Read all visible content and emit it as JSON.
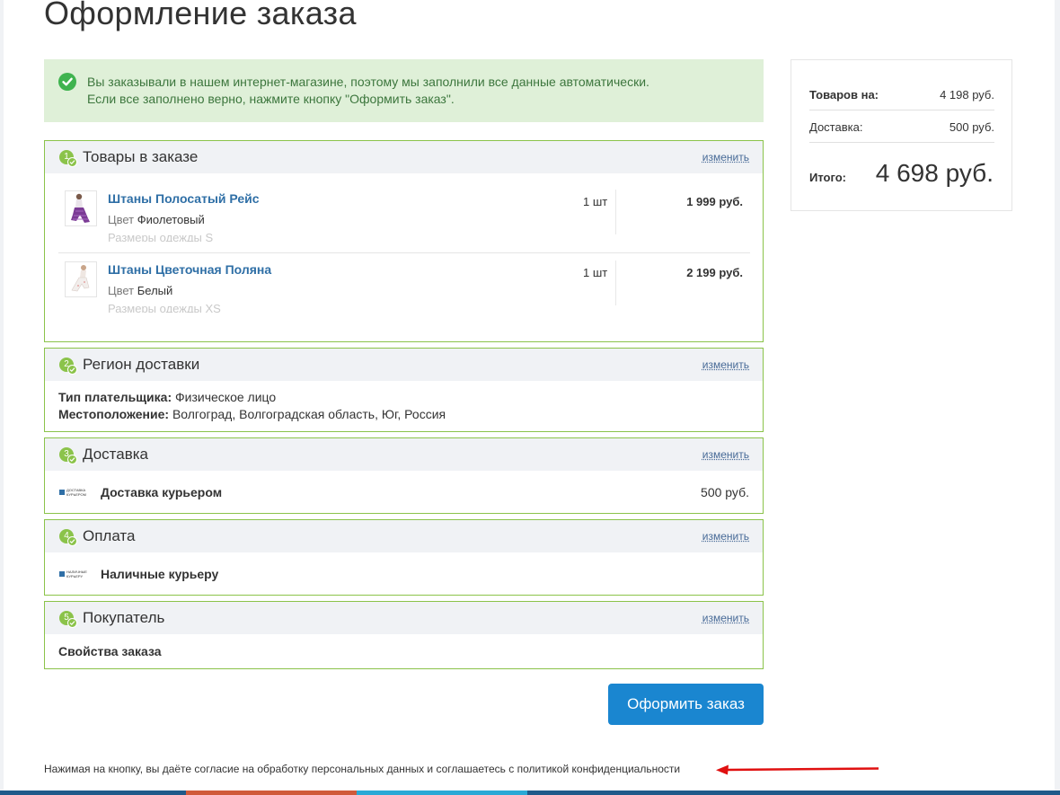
{
  "page": {
    "title": "Оформление заказа"
  },
  "notice": {
    "line1": "Вы заказывали в нашем интернет-магазине, поэтому мы заполнили все данные автоматически.",
    "line2": "Если все заполнено верно, нажмите кнопку \"Оформить заказ\"."
  },
  "change_label": "изменить",
  "sections": {
    "goods": {
      "num": "1",
      "title": "Товары в заказе"
    },
    "region": {
      "num": "2",
      "title": "Регион доставки"
    },
    "delivery": {
      "num": "3",
      "title": "Доставка"
    },
    "payment": {
      "num": "4",
      "title": "Оплата"
    },
    "buyer": {
      "num": "5",
      "title": "Покупатель"
    }
  },
  "products": [
    {
      "name": "Штаны Полосатый Рейс",
      "color_label": "Цвет",
      "color_value": "Фиолетовый",
      "size": "Размеры одежды S",
      "qty": "1 шт",
      "price": "1 999 руб."
    },
    {
      "name": "Штаны Цветочная Поляна",
      "color_label": "Цвет",
      "color_value": "Белый",
      "size": "Размеры одежды XS",
      "qty": "1 шт",
      "price": "2 199 руб."
    }
  ],
  "region": {
    "payer_label": "Тип плательщика:",
    "payer_value": "Физическое лицо",
    "location_label": "Местоположение:",
    "location_value": "Волгоград, Волгоградская область, Юг, Россия"
  },
  "delivery": {
    "logo_text1": "ДОСТАВКА",
    "logo_text2": "КУРЬЕРОМ",
    "name": "Доставка курьером",
    "price": "500 руб."
  },
  "payment": {
    "logo_text1": "НАЛИЧНЫЕ",
    "logo_text2": "КУРЬЕРУ",
    "name": "Наличные курьеру"
  },
  "buyer": {
    "props_label": "Свойства заказа"
  },
  "submit_label": "Оформить заказ",
  "consent": "Нажимая на кнопку, вы даёте согласие на обработку персональных данных и соглашаетесь с политикой конфиденциальности",
  "summary": {
    "goods_label": "Товаров на:",
    "goods_value": "4 198 руб.",
    "delivery_label": "Доставка:",
    "delivery_value": "500 руб.",
    "total_label": "Итого:",
    "total_value": "4 698 руб."
  },
  "colors": {
    "accent_green": "#8bc34a",
    "button_blue": "#1a86d0",
    "link_blue": "#2f6fa6",
    "notice_bg": "#dff0d8",
    "arrow_red": "#e01010"
  },
  "icons": {
    "notice": "check-circle-icon",
    "section_state": "check-mini-icon",
    "arrow": "red-arrow-annotation"
  }
}
